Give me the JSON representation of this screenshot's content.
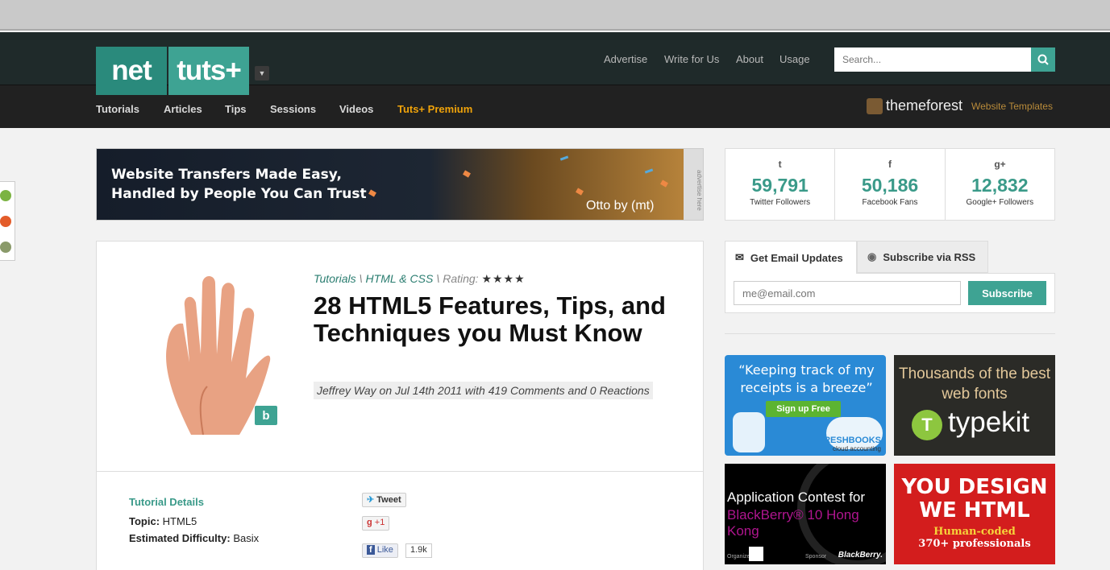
{
  "header": {
    "logo_left": "net",
    "logo_right": "tuts+",
    "top_links": [
      "Advertise",
      "Write for Us",
      "About",
      "Usage"
    ],
    "search_placeholder": "Search...",
    "nav": [
      "Tutorials",
      "Articles",
      "Tips",
      "Sessions",
      "Videos",
      "Tuts+ Premium"
    ],
    "themeforest": "themeforest",
    "themeforest_link": "Website Templates"
  },
  "banner_ad": {
    "line1": "Website Transfers Made Easy,",
    "line2": "Handled by People You Can Trust",
    "brand": "Otto by (mt)",
    "side_label": "advertise here"
  },
  "article": {
    "crumbs": [
      "Tutorials",
      "HTML & CSS"
    ],
    "rating_label": "Rating:",
    "stars": "★★★★",
    "rating_value": 4,
    "title": "28 HTML5 Features, Tips, and Techniques you Must Know",
    "byline": "Jeffrey Way on Jul 14th 2011 with 419 Comments and 0 Reactions",
    "badge": "b",
    "details_title": "Tutorial Details",
    "topic_label": "Topic:",
    "topic_value": "HTML5",
    "difficulty_label": "Estimated Difficulty:",
    "difficulty_value": "Basix",
    "tweet": "Tweet",
    "gplus": "+1",
    "fb_like": "Like",
    "fb_count": "1.9k"
  },
  "social": [
    {
      "icon": "twitter-icon",
      "glyph": "t",
      "count": "59,791",
      "label": "Twitter Followers"
    },
    {
      "icon": "facebook-icon",
      "glyph": "f",
      "count": "50,186",
      "label": "Facebook Fans"
    },
    {
      "icon": "google-plus-icon",
      "glyph": "g+",
      "count": "12,832",
      "label": "Google+ Followers"
    }
  ],
  "subscribe": {
    "tab_email": "Get Email Updates",
    "tab_rss": "Subscribe via RSS",
    "email_placeholder": "me@email.com",
    "button": "Subscribe"
  },
  "ads": {
    "freshbooks_quote": "“Keeping track of my receipts is a breeze”",
    "freshbooks_button": "Sign up Free",
    "freshbooks_brand": "FRESHBOOKS",
    "freshbooks_sub": "cloud accounting",
    "typekit_text": "Thousands of the best web fonts",
    "typekit_word": "typekit",
    "bb_line1": "Application Contest for",
    "bb_line2": "BlackBerry® 10 Hong Kong",
    "bb_org": "Organizer",
    "bb_sponsor": "Sponsor",
    "bb_brand": "BlackBerry.",
    "ywh_line1": "YOU DESIGN",
    "ywh_line2": "WE HTML",
    "ywh_line3": "Human-coded",
    "ywh_line4": "370+ professionals"
  },
  "colors": {
    "accent": "#3ea393",
    "premium": "#f0a30a"
  }
}
